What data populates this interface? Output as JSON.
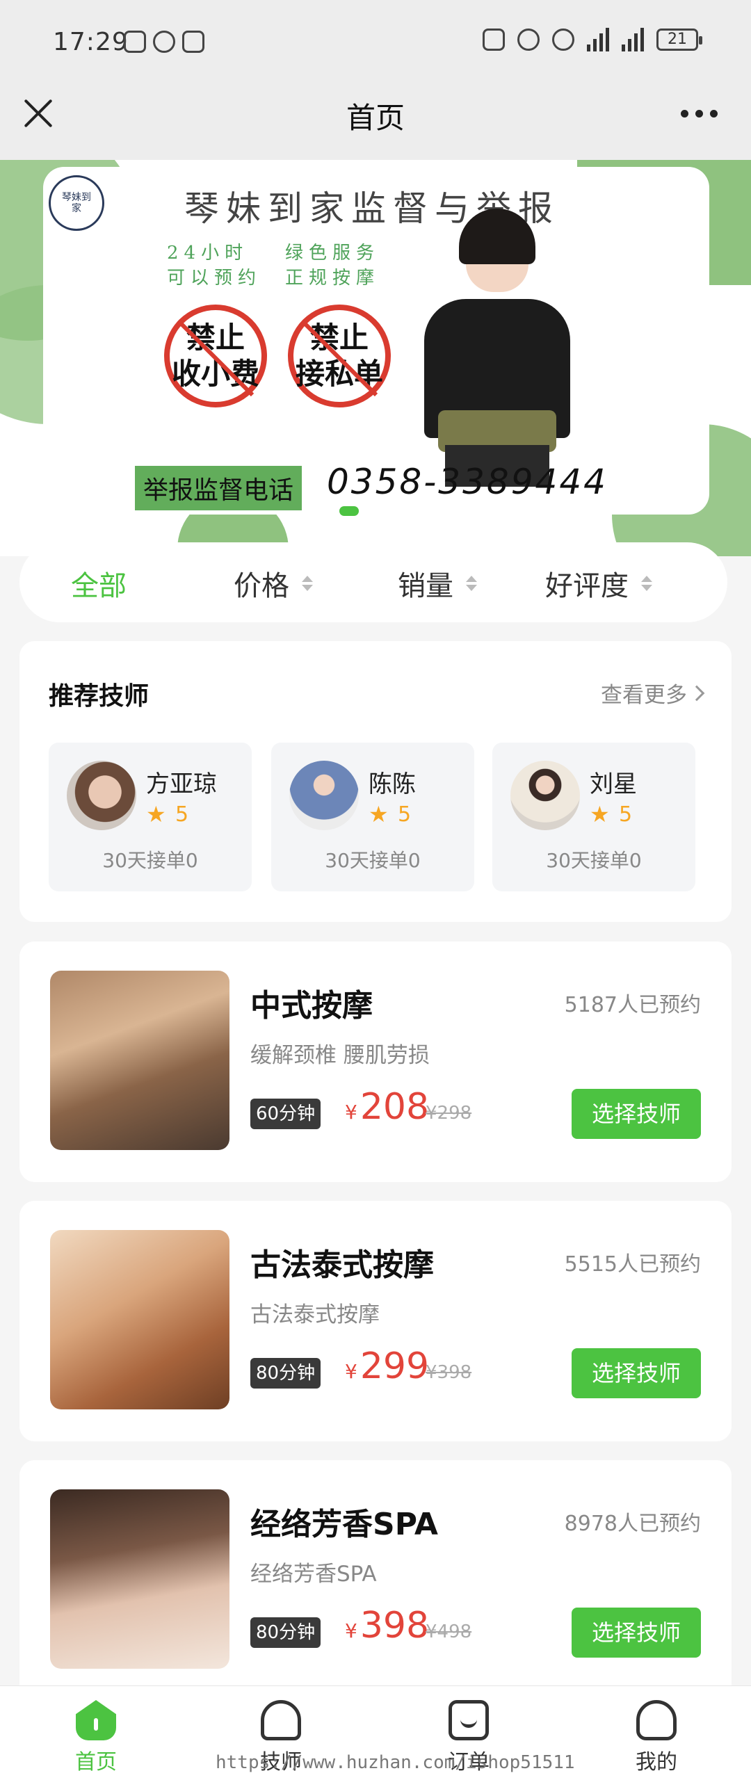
{
  "status_bar": {
    "time": "17:29",
    "battery": "21"
  },
  "nav": {
    "title": "首页"
  },
  "banner": {
    "logo_text": "琴妹到家",
    "title": "琴妹到家监督与举报",
    "feature_left": [
      "24小时",
      "可以预约"
    ],
    "feature_right": [
      "绿色服务",
      "正规按摩"
    ],
    "forbid_1": [
      "禁止",
      "收小费"
    ],
    "forbid_2": [
      "禁止",
      "接私单"
    ],
    "phone_label": "举报监督电话",
    "phone": "0358-3389444"
  },
  "sort_tabs": [
    {
      "label": "全部",
      "active": true
    },
    {
      "label": "价格",
      "active": false
    },
    {
      "label": "销量",
      "active": false
    },
    {
      "label": "好评度",
      "active": false
    }
  ],
  "recommend": {
    "title": "推荐技师",
    "more": "查看更多",
    "technicians": [
      {
        "name": "方亚琼",
        "score": "5",
        "orders": "30天接单0"
      },
      {
        "name": "陈陈",
        "score": "5",
        "orders": "30天接单0"
      },
      {
        "name": "刘星",
        "score": "5",
        "orders": "30天接单0"
      }
    ]
  },
  "services": [
    {
      "name": "中式按摩",
      "booked": "5187人已预约",
      "desc": "缓解颈椎 腰肌劳损",
      "duration": "60分钟",
      "currency": "¥",
      "price": "208",
      "original": "¥298",
      "button": "选择技师"
    },
    {
      "name": "古法泰式按摩",
      "booked": "5515人已预约",
      "desc": "古法泰式按摩",
      "duration": "80分钟",
      "currency": "¥",
      "price": "299",
      "original": "¥398",
      "button": "选择技师"
    },
    {
      "name": "经络芳香SPA",
      "booked": "8978人已预约",
      "desc": "经络芳香SPA",
      "duration": "80分钟",
      "currency": "¥",
      "price": "398",
      "original": "¥498",
      "button": "选择技师"
    }
  ],
  "tabbar": [
    {
      "label": "首页",
      "icon": "home-icon",
      "active": true
    },
    {
      "label": "技师",
      "icon": "technician-icon",
      "active": false
    },
    {
      "label": "订单",
      "icon": "order-icon",
      "active": false
    },
    {
      "label": "我的",
      "icon": "profile-icon",
      "active": false
    }
  ],
  "watermark": "https://www.huzhan.com/ishop51511",
  "colors": {
    "accent": "#4cc341",
    "price": "#e2443a",
    "banner_green": "#8fc27f"
  }
}
